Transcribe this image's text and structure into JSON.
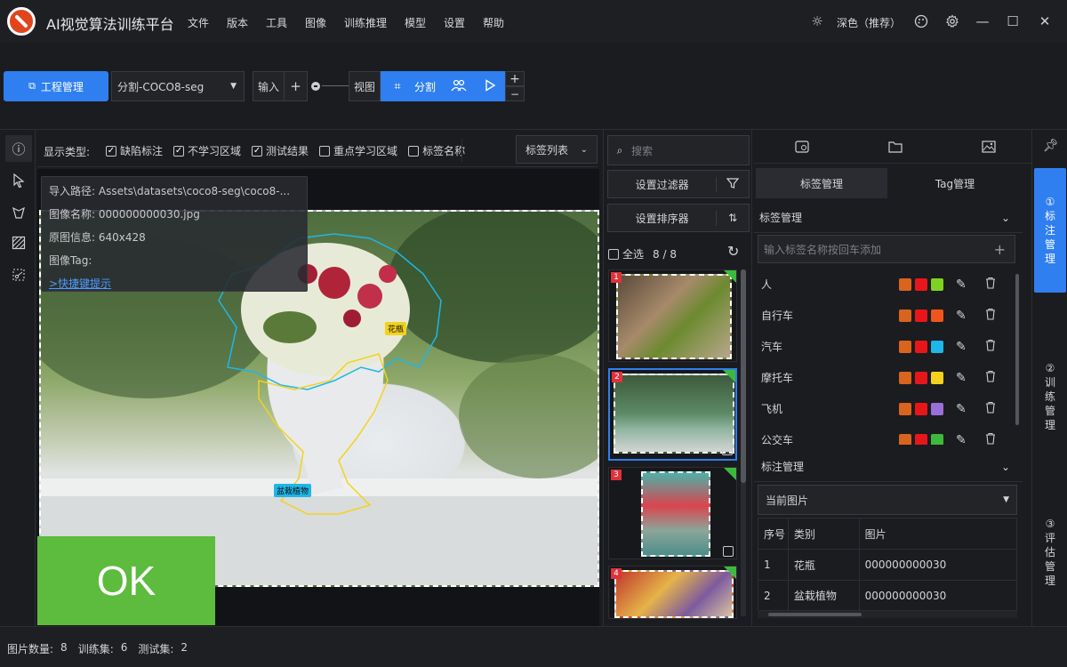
{
  "app": {
    "title": "AI视觉算法训练平台"
  },
  "menu": [
    "文件",
    "版本",
    "工具",
    "图像",
    "训练推理",
    "模型",
    "设置",
    "帮助"
  ],
  "theme_label": "深色（推荐）",
  "toolbar": {
    "project_btn": "工程管理",
    "project_select": "分割-COCO8-seg",
    "input_label": "输入",
    "plus": "+",
    "view_label": "视图",
    "seg_label": "分割",
    "zoom_plus": "+",
    "zoom_minus": "−"
  },
  "display": {
    "type_label": "显示类型:",
    "options": [
      {
        "label": "缺陷标注",
        "checked": true
      },
      {
        "label": "不学习区域",
        "checked": true
      },
      {
        "label": "测试结果",
        "checked": true
      },
      {
        "label": "重点学习区域",
        "checked": false
      },
      {
        "label": "标签名称",
        "checked": false
      }
    ],
    "list_btn": "标签列表"
  },
  "info": {
    "path": "导入路径: Assets\\datasets\\coco8-seg\\coco8-...",
    "name": "图像名称: 000000000030.jpg",
    "orig": "原图信息: 640x428",
    "tag": "图像Tag:",
    "hint": ">快捷键提示"
  },
  "canvas": {
    "ok": "OK",
    "tag_vase": "花瓶",
    "tag_plant": "盆栽植物"
  },
  "thumbs": {
    "search_placeholder": "搜索",
    "filter_btn": "设置过滤器",
    "sort_btn": "设置排序器",
    "select_all": "全选",
    "count": "8 / 8",
    "items": [
      "1",
      "2",
      "3",
      "4"
    ]
  },
  "right": {
    "tab_label": "标签管理",
    "tab_tag": "Tag管理",
    "label_section": "标签管理",
    "input_placeholder": "输入标签名称按回车添加",
    "labels": [
      {
        "name": "人",
        "c1": "#d9641e",
        "c2": "#e8161b",
        "c3": "#7ed321"
      },
      {
        "name": "自行车",
        "c1": "#d9641e",
        "c2": "#e8161b",
        "c3": "#f0561c"
      },
      {
        "name": "汽车",
        "c1": "#d9641e",
        "c2": "#e8161b",
        "c3": "#1fb6e8"
      },
      {
        "name": "摩托车",
        "c1": "#d9641e",
        "c2": "#e8161b",
        "c3": "#f4d21c"
      },
      {
        "name": "飞机",
        "c1": "#d9641e",
        "c2": "#e8161b",
        "c3": "#9b6fd8"
      },
      {
        "name": "公交车",
        "c1": "#d9641e",
        "c2": "#e8161b",
        "c3": "#3dba3d"
      }
    ],
    "anno_section": "标注管理",
    "anno_select": "当前图片",
    "table_headers": [
      "序号",
      "类别",
      "图片"
    ],
    "table_rows": [
      [
        "1",
        "花瓶",
        "000000000030"
      ],
      [
        "2",
        "盆栽植物",
        "000000000030"
      ]
    ]
  },
  "sidetabs": [
    {
      "num": "①",
      "text": "标注管理",
      "active": true
    },
    {
      "num": "②",
      "text": "训练管理",
      "active": false
    },
    {
      "num": "③",
      "text": "评估管理",
      "active": false
    }
  ],
  "status": {
    "count_label": "图片数量:",
    "count": "8",
    "train_label": "训练集:",
    "train": "6",
    "test_label": "测试集:",
    "test": "2"
  },
  "colors": {
    "accent": "#2f7ff0",
    "ok_green": "#5dbb3d",
    "bg": "#1b1c20"
  }
}
